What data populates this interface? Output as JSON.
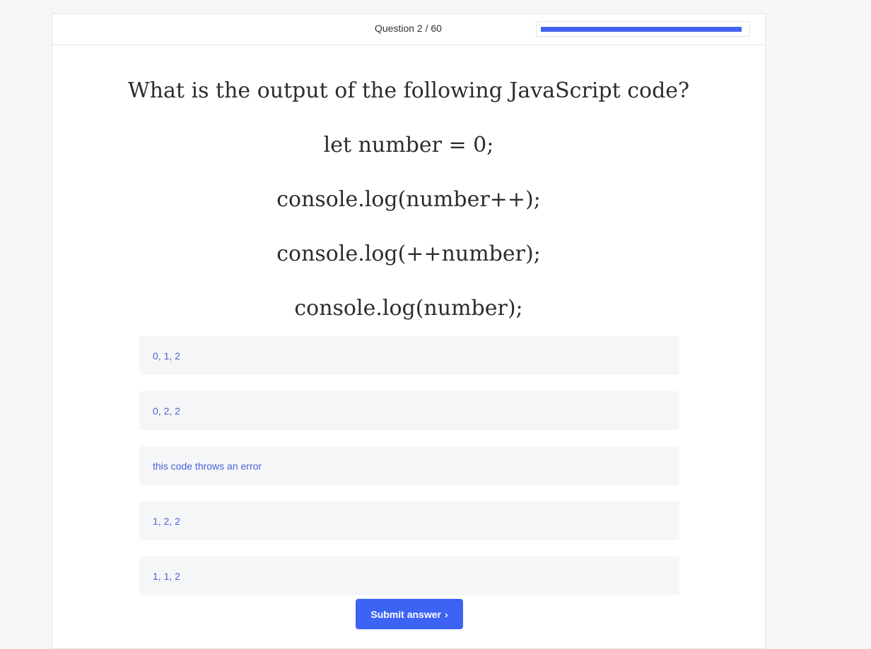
{
  "header": {
    "counter": "Question 2 / 60",
    "progress_fraction": 0.9833
  },
  "question": {
    "lines": [
      "What is the output of the following JavaScript code?",
      "let number = 0;",
      "console.log(number++);",
      "console.log(++number);",
      "console.log(number);"
    ]
  },
  "options": [
    "0, 1, 2",
    "0, 2, 2",
    "this code throws an error",
    "1, 2, 2",
    "1, 1, 2"
  ],
  "submit": {
    "label": "Submit answer",
    "icon": "chevron-right-icon",
    "glyph": "›"
  },
  "colors": {
    "accent": "#3d63f5",
    "option_text": "#4a62d6",
    "option_bg": "#f5f6f8"
  }
}
